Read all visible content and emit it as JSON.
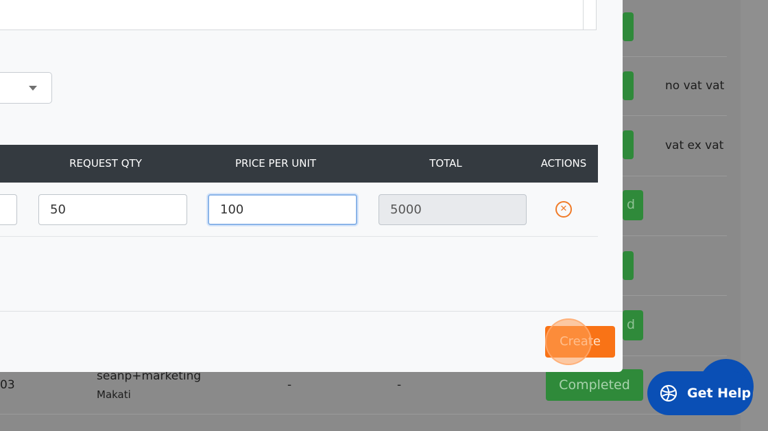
{
  "background": {
    "rows": [
      {
        "note": ""
      },
      {
        "note": "no vat vat"
      },
      {
        "note": "vat ex vat"
      }
    ],
    "pill_partial": "d",
    "bottom_row": {
      "id_fragment": "03",
      "name": "seanp+marketing",
      "location": "Makati",
      "col3": "-",
      "col4": "-",
      "status": "Completed"
    }
  },
  "modal": {
    "table": {
      "headers": [
        "REQUEST QTY",
        "PRICE PER UNIT",
        "TOTAL",
        "ACTIONS"
      ],
      "row": {
        "request_qty": "50",
        "price_per_unit": "100",
        "total": "5000"
      }
    },
    "create_label": "Create"
  },
  "help": {
    "label": "Get Help"
  },
  "colors": {
    "header_bg": "#343a40",
    "accent_orange": "#f97316",
    "status_green": "#2f8a3a",
    "help_blue": "#0a4fb5"
  },
  "icons": {
    "remove": "close-circle-icon",
    "dropdown": "chevron-down-icon",
    "help": "globe-icon"
  }
}
